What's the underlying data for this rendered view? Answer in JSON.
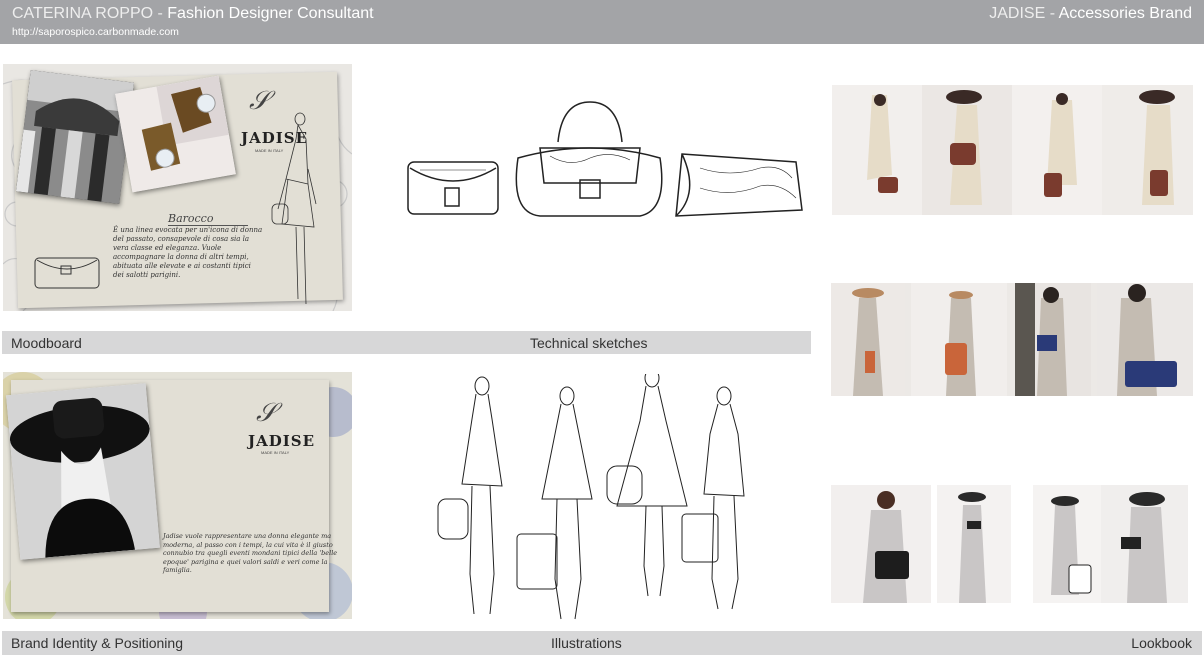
{
  "header": {
    "designer_name": "CATERINA ROPPO",
    "designer_role": "Fashion Designer Consultant",
    "url": "http://saporospico.carbonmade.com",
    "brand_name": "JADISE",
    "brand_type": "Accessories Brand",
    "separator": " - "
  },
  "sections": {
    "moodboard": "Moodboard",
    "technical_sketches": "Technical sketches",
    "brand_identity": "Brand Identity & Positioning",
    "illustrations": "Illustrations",
    "lookbook": "Lookbook"
  },
  "moodboard_card": {
    "logo": "JADISE",
    "logo_tag": "MADE IN ITALY",
    "collection_title": "Barocco",
    "text": "È una linea evocata per un'icona di donna del passato, consapevole di cosa sia la vera classe ed eleganza. Vuole accompagnare la donna di altri tempi, abituata alle elevate e ai costanti tipici dei salotti parigini."
  },
  "brand_card": {
    "logo": "JADISE",
    "logo_tag": "MADE IN ITALY",
    "text": "Jadise vuole rappresentare una donna elegante ma moderna, al passo con i tempi, la cui vita è il giusto connubio tra quegli eventi mondani tipici della 'belle epoque' parigina e quei valori saldi e veri come la famiglia."
  },
  "colors": {
    "header_bg": "#a3a4a7",
    "label_bar": "#d7d7d8",
    "bag_brown": "#7a3b2e",
    "bag_blue": "#2a3a78",
    "bag_orange": "#c9653a"
  }
}
